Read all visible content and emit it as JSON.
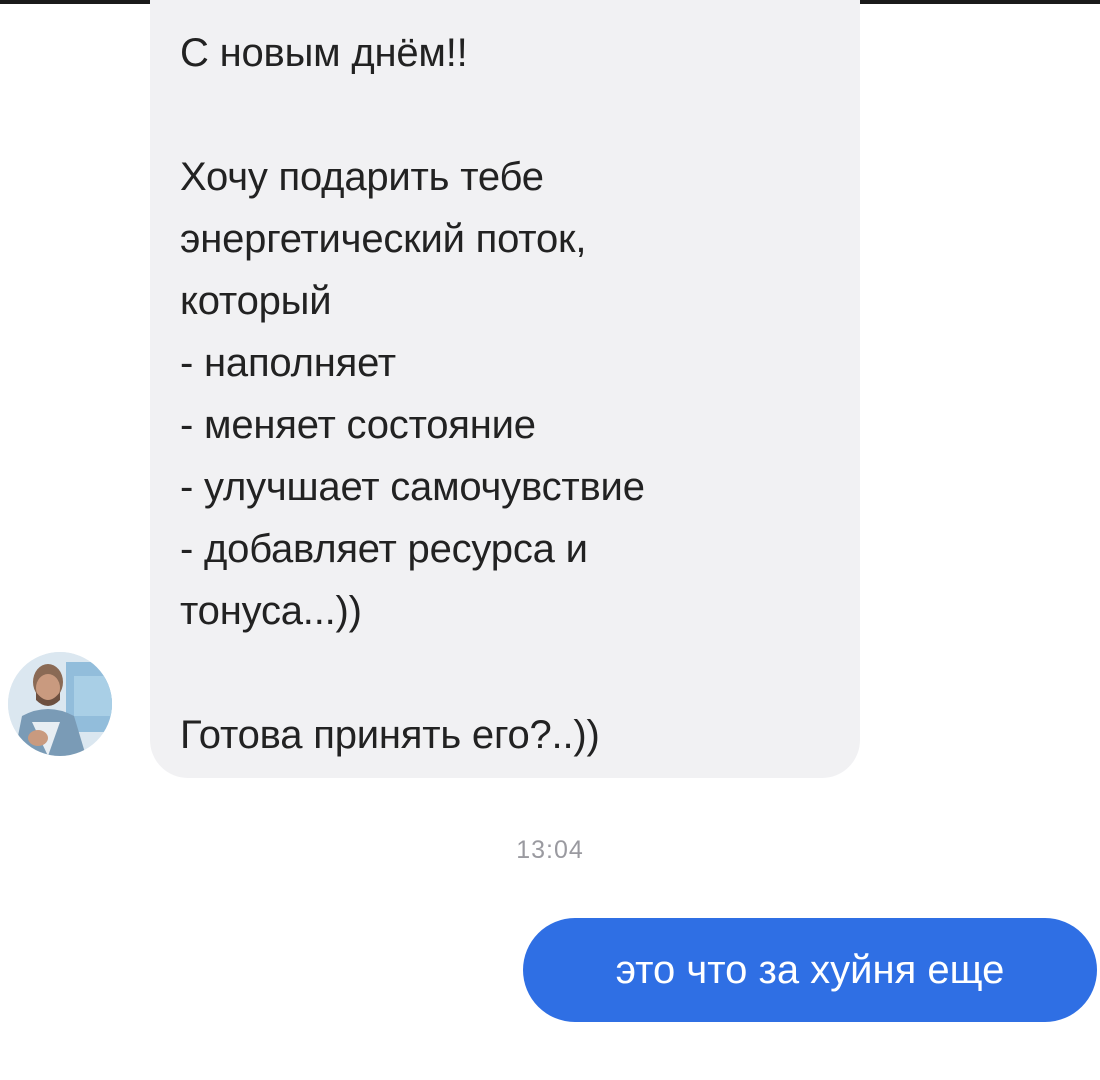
{
  "conversation": {
    "incoming": {
      "lines": [
        "С новым днём!!",
        "",
        "Хочу подарить тебе",
        "энергетический поток,",
        "который",
        "- наполняет",
        "- меняет состояние",
        "- улучшает самочувствие",
        "- добавляет ресурса и",
        "тонуса...))",
        "",
        "Готова принять его?..))"
      ]
    },
    "timestamp": "13:04",
    "outgoing": {
      "text": "это что за хуйня еще"
    }
  },
  "colors": {
    "incoming_bubble": "#f1f1f3",
    "outgoing_bubble": "#2f6fe4",
    "timestamp": "#9a9aa0"
  },
  "icons": {
    "avatar": "contact-avatar-photo"
  }
}
